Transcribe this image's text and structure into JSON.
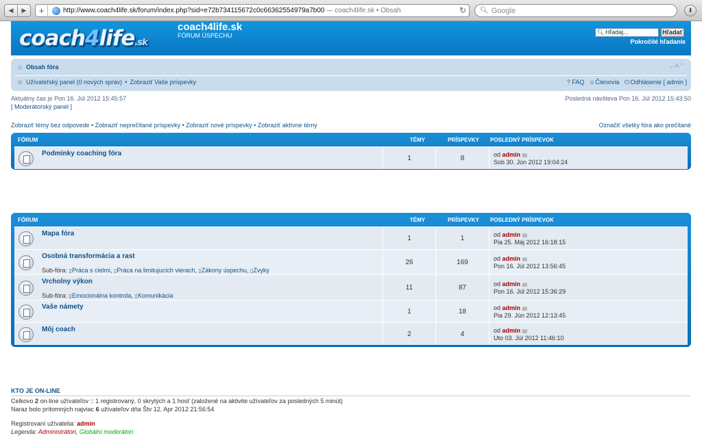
{
  "browser": {
    "url": "http://www.coach4life.sk/forum/index.php?sid=e72b734115672c0c66362554979a7b00",
    "tab_title": "— coach4life.sk • Obsah",
    "search_placeholder": "Google"
  },
  "header": {
    "logo_main": "coach",
    "logo_four": "4",
    "logo_life": "life",
    "logo_tld": ".sk",
    "site_title": "coach4life.sk",
    "site_desc": "FÓRUM ÚSPECHU",
    "search_value": "Hľadaj...",
    "search_button": "Hľadať",
    "advanced_search": "Pokročilé hľadanie"
  },
  "navbar": {
    "index_link": "Obsah fóra",
    "font_size": "A",
    "user_panel": "Užívateľský panel (0 nových správ)",
    "view_posts": "Zobraziť Vaše príspevky",
    "faq": "FAQ",
    "members": "Členovia",
    "logout": "Odhlásenie [ admin ]"
  },
  "info": {
    "current_time": "Aktuálny čas je Pon 16. Júl 2012 15:45:57",
    "mod_panel": "[ Moderátorský panel ]",
    "last_visit": "Posledná návšteva Pon 16. Júl 2012 15:43:50"
  },
  "links": {
    "unanswered": "Zobraziť témy bez odpovede",
    "unread": "Zobraziť neprečítané príspevky",
    "new_posts": "Zobraziť nové príspevky",
    "active": "Zobraziť aktívne témy",
    "mark_read": "Označiť všetky fóra ako prečítané",
    "sep": "•"
  },
  "table_headers": {
    "forum": "FÓRUM",
    "topics": "TÉMY",
    "posts": "PRÍSPEVKY",
    "last_post": "POSLEDNÝ PRÍSPEVOK"
  },
  "forums1": [
    {
      "name": "Podmínky coaching fóra",
      "topics": "1",
      "posts": "8",
      "by": "od",
      "author": "admin",
      "date": "Sob 30. Jún 2012 19:04:24"
    }
  ],
  "forums2": [
    {
      "name": "Mapa fóra",
      "topics": "1",
      "posts": "1",
      "by": "od",
      "author": "admin",
      "date": "Pia 25. Máj 2012 16:18:15"
    },
    {
      "name": "Osobná transformácia a rast",
      "topics": "26",
      "posts": "169",
      "by": "od",
      "author": "admin",
      "date": "Pon 16. Júl 2012 13:56:45",
      "sub_label": "Sub-fóra:",
      "subs": [
        "Práca s cielmi",
        "Práca na limitujucich vierach",
        "Zákony úspechu",
        "Zvyky"
      ]
    },
    {
      "name": "Vrcholny výkon",
      "topics": "11",
      "posts": "87",
      "by": "od",
      "author": "admin",
      "date": "Pon 16. Júl 2012 15:36:29",
      "sub_label": "Sub-fóra:",
      "subs": [
        "Emocionálna kontrola",
        "Komunikácia"
      ]
    },
    {
      "name": "Vaše námety",
      "topics": "1",
      "posts": "18",
      "by": "od",
      "author": "admin",
      "date": "Pia 29. Jún 2012 12:13:45"
    },
    {
      "name": "Môj coach",
      "topics": "2",
      "posts": "4",
      "by": "od",
      "author": "admin",
      "date": "Uto 03. Júl 2012 11:46:10"
    }
  ],
  "online": {
    "heading": "KTO JE ON-LINE",
    "line1_a": "Celkovo",
    "line1_count": "2",
    "line1_b": "on-line užívateľov :: 1 registrovaný, 0 skrytých a 1 hosť (založené na aktivite užívateľov za posledných 5 minút)",
    "line2_a": "Naraz bolo prítomných najviac",
    "line2_count": "6",
    "line2_b": "užívateľov dňa Štv 12. Apr 2012 21:56:54",
    "registered_label": "Registrovaní užívatelia:",
    "registered_user": "admin",
    "legend_label": "Legenda:",
    "legend_admins": "Administrátori",
    "legend_mods": "Globálni moderátori",
    "legend_sep": ","
  }
}
